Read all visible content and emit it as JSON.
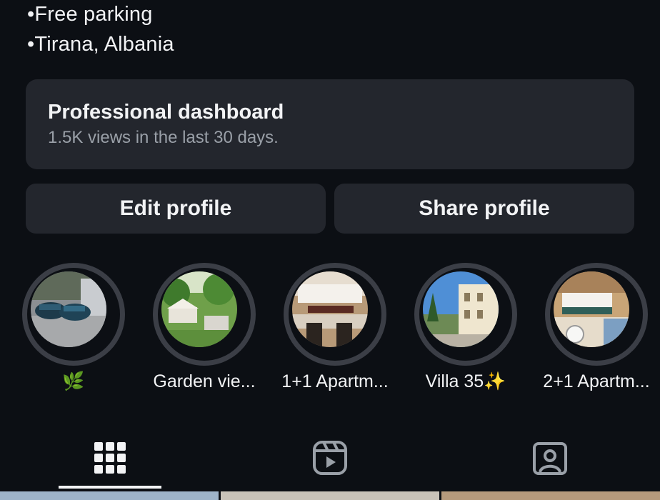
{
  "bio": {
    "line1": "•Free parking",
    "line2": "•Tirana, Albania"
  },
  "dashboard": {
    "title": "Professional dashboard",
    "subtitle": "1.5K views in the last 30 days."
  },
  "actions": {
    "edit_label": "Edit profile",
    "share_label": "Share profile"
  },
  "highlights": [
    {
      "label": "🌿",
      "image": "cars-parking"
    },
    {
      "label": "Garden vie...",
      "image": "garden"
    },
    {
      "label": "1+1 Apartm...",
      "image": "bedroom-book-your-stay"
    },
    {
      "label": "Villa 35✨",
      "image": "villa-exterior"
    },
    {
      "label": "2+1 Apartm...",
      "image": "bedroom-laundry"
    }
  ],
  "tabs": [
    {
      "name": "posts-grid",
      "icon": "grid-icon",
      "active": true
    },
    {
      "name": "reels",
      "icon": "reels-icon",
      "active": false
    },
    {
      "name": "tagged",
      "icon": "tagged-person-icon",
      "active": false
    }
  ],
  "colors": {
    "background": "#0c0f14",
    "card": "#23262d",
    "ring": "#3b3e46",
    "text": "#f2f3f5",
    "muted": "#9aa0a8"
  }
}
